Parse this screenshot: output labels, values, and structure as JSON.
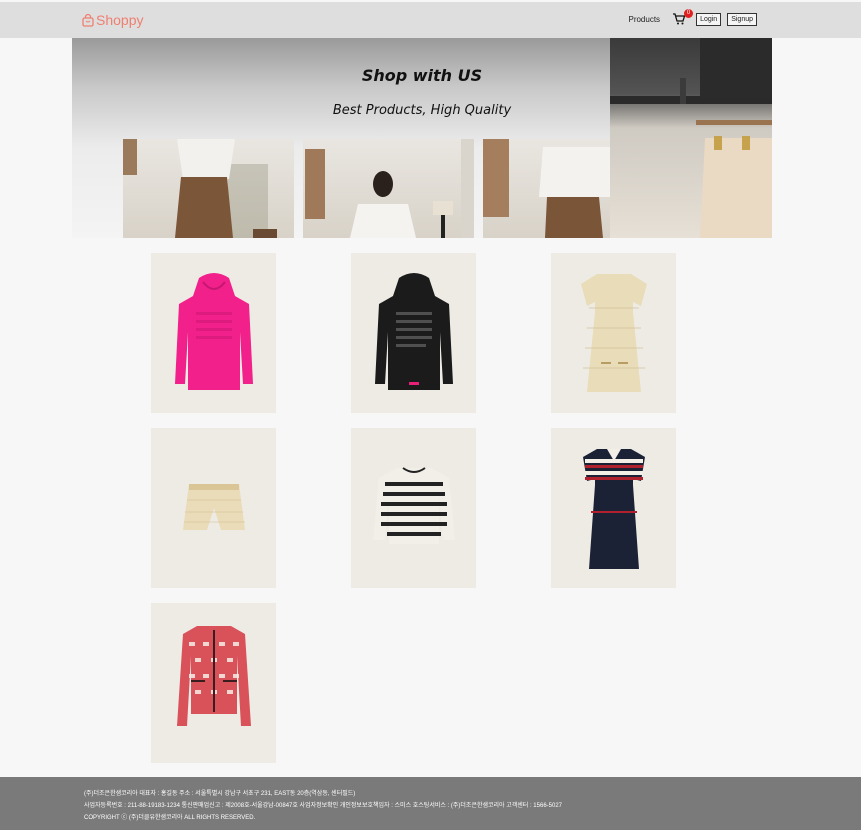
{
  "header": {
    "brand": "Shoppy",
    "nav_products": "Products",
    "cart_count": "0",
    "login_label": "Login",
    "signup_label": "Signup",
    "brand_color": "#ef7f6f"
  },
  "hero": {
    "title": "Shop with US",
    "subtitle": "Best Products, High Quality"
  },
  "products": [
    {
      "name": "pink-hoodie",
      "icon": "hoodie",
      "color": "#f2208a"
    },
    {
      "name": "black-hoodie",
      "icon": "hoodie",
      "color": "#1b1b1b"
    },
    {
      "name": "tweed-dress",
      "icon": "dress",
      "color": "#e9dcb8"
    },
    {
      "name": "tweed-shorts",
      "icon": "shorts",
      "color": "#eadcb8"
    },
    {
      "name": "striped-sweater",
      "icon": "sweater",
      "color": "#222222"
    },
    {
      "name": "navy-striped-dress",
      "icon": "dress",
      "color": "#1c2236"
    },
    {
      "name": "red-pattern-jacket",
      "icon": "jacket",
      "color": "#d9525a"
    }
  ],
  "footer": {
    "line1": "(주)더조은한샘코리아 대표자 : 홍길동 주소 : 서울특별시 강남구 서초구 231, EAST동 20층(역삼동, 센터필드)",
    "line2": "사업자등록번호 : 211-88-19183-1234 통신판매업신고 : 제2008호-서울강남-00847호 사업자정보확인 개인정보보호책임자 : 스미스 호스팅서비스 : (주)더조은한샘코리아 고객센터 : 1566-5027",
    "line3": "COPYRIGHT ⓒ (주)더클유한샘코리아 ALL RIGHTS RESERVED."
  }
}
